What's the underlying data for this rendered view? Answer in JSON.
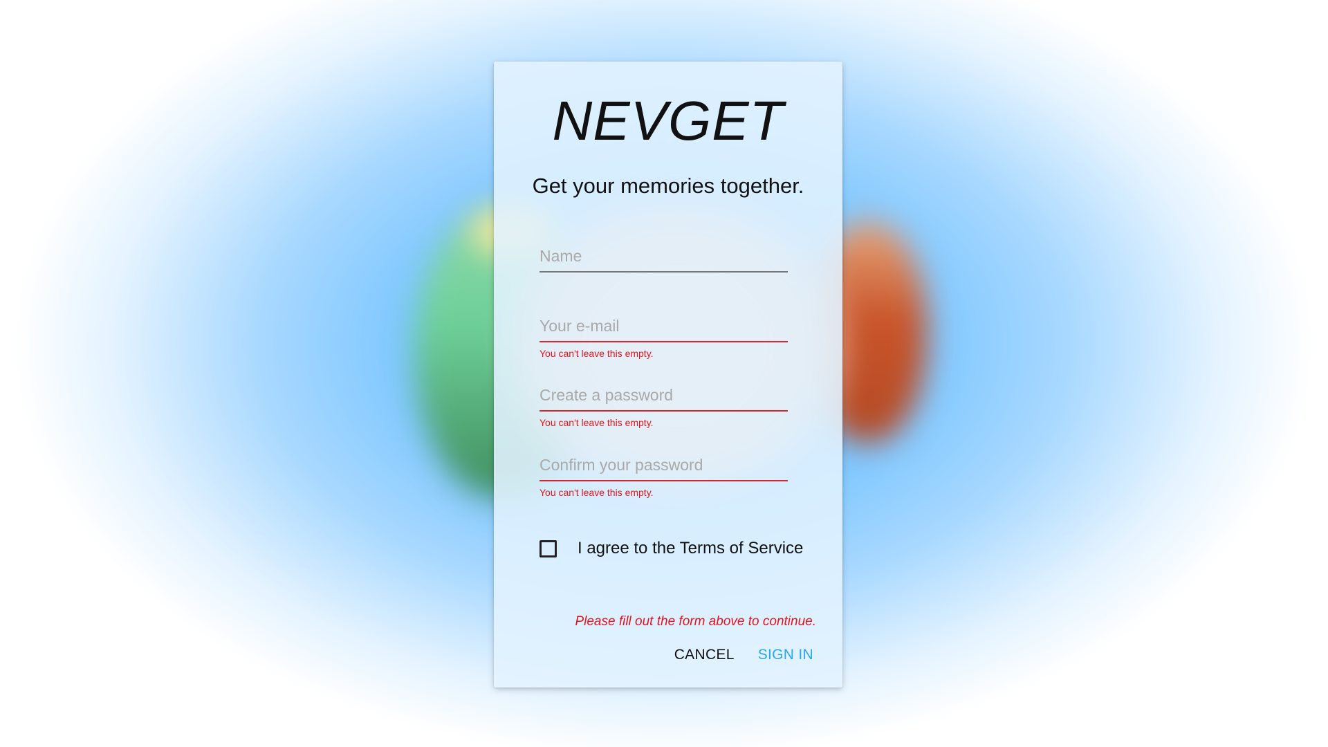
{
  "app": {
    "logo": "NEVGET",
    "tagline": "Get your memories together."
  },
  "form": {
    "name": {
      "placeholder": "Name",
      "value": ""
    },
    "email": {
      "placeholder": "Your e-mail",
      "value": "",
      "error": "You can't leave this empty."
    },
    "password": {
      "placeholder": "Create a password",
      "value": "",
      "error": "You can't leave this empty."
    },
    "confirm": {
      "placeholder": "Confirm your password",
      "value": "",
      "error": "You can't leave this empty."
    },
    "terms_label": "I agree to the Terms of Service",
    "terms_checked": false,
    "message": "Please fill out the form above to continue."
  },
  "actions": {
    "cancel_label": "CANCEL",
    "signin_label": "SIGN IN"
  },
  "colors": {
    "accent": "#2ba6ef",
    "error": "#e1141c",
    "background": "#5fbaff"
  }
}
